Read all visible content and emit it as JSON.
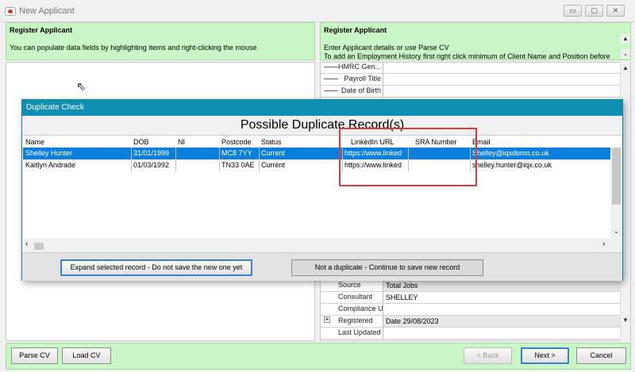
{
  "window": {
    "title": "New Applicant",
    "controls": {
      "minimize": "▭",
      "maximize": "▢",
      "close": "✕"
    }
  },
  "left_panel": {
    "title": "Register Applicant",
    "hint": "You can populate data fields by highlighting items and right-clicking the mouse"
  },
  "right_panel": {
    "title": "Register Applicant",
    "desc1": "Enter Applicant details or use Parse CV",
    "desc2": "To add an Employment History first right click minimum of Client Name and Position before",
    "top_rows": [
      {
        "label": "HMRC Gen...",
        "value": ""
      },
      {
        "label": "Payroll Title",
        "value": ""
      },
      {
        "label": "Date of Birth",
        "value": ""
      }
    ],
    "bottom_rows": [
      {
        "label": "Source",
        "value": "Total Jobs"
      },
      {
        "label": "Consultant",
        "value": "SHELLEY"
      },
      {
        "label": "Compliance U...",
        "value": ""
      },
      {
        "label": "Registered",
        "value": "Date 29/08/2023"
      },
      {
        "label": "Last Updated",
        "value": ""
      }
    ]
  },
  "dialog": {
    "title": "Duplicate Check",
    "heading": "Possible Duplicate Record(s)",
    "columns": [
      "Name",
      "DOB",
      "NI",
      "Postcode",
      "Status",
      "LinkedIn URL",
      "SRA Number",
      "Email"
    ],
    "rows": [
      {
        "name": "Shelley Hunter",
        "dob": "31/01/1999",
        "ni": "",
        "postcode": "MC8 7YY",
        "status": "Current",
        "linkedin": "https://www.linked",
        "sra": "",
        "email": "Shelley@iqxdemo.co.uk",
        "selected": true
      },
      {
        "name": "Kaitlyn Andrade",
        "dob": "01/03/1992",
        "ni": "",
        "postcode": "TN33 0AE",
        "status": "Current",
        "linkedin": "https://www.linked",
        "sra": "",
        "email": "shelley.hunter@iqx.co.uk",
        "selected": false
      }
    ],
    "expand_button": "Expand selected record - Do not save the new one yet",
    "not_duplicate_button": "Not a duplicate - Continue to save new record"
  },
  "bottom_bar": {
    "parse_cv": "Parse CV",
    "load_cv": "Load CV",
    "back": "< Back",
    "next": "Next >",
    "cancel": "Cancel"
  },
  "colors": {
    "panel_green": "#c8f7c5",
    "dialog_title": "#0f8fb2",
    "selection": "#0c7fde",
    "highlight": "#e23a3a"
  }
}
